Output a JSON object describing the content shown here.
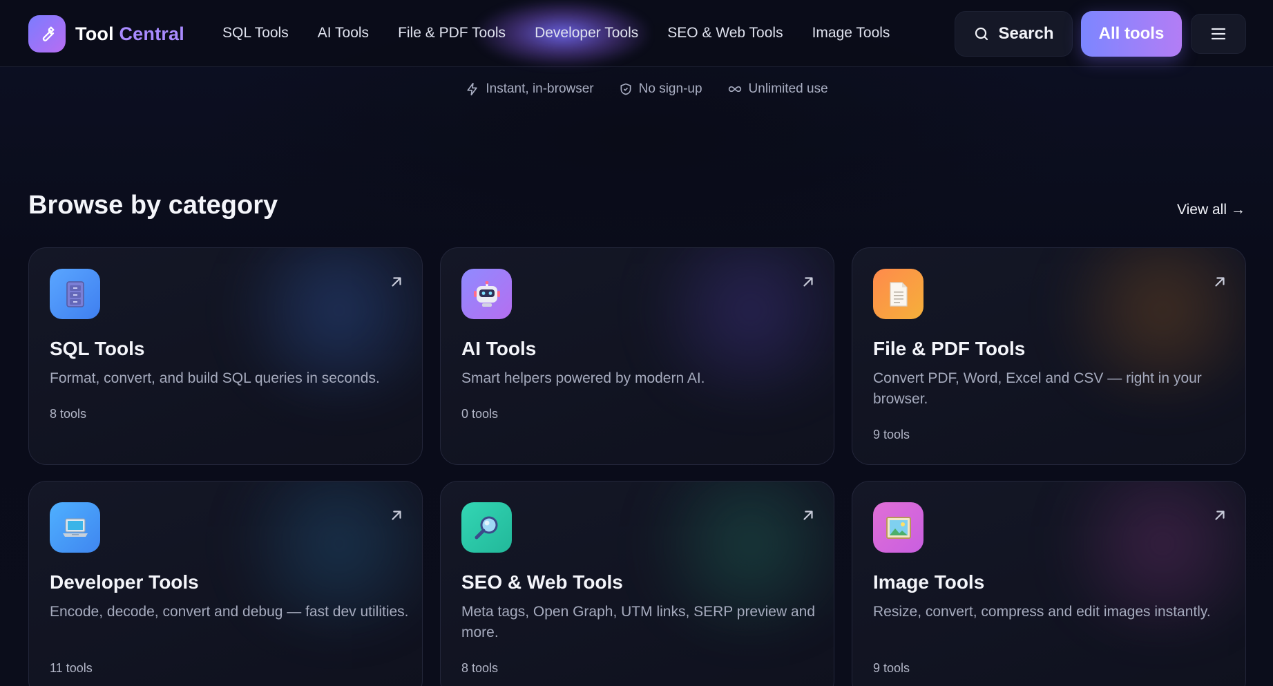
{
  "brand": {
    "name_part1": "Tool ",
    "name_part2": "Central"
  },
  "nav": {
    "links": [
      "SQL Tools",
      "AI Tools",
      "File & PDF Tools",
      "Developer Tools",
      "SEO & Web Tools",
      "Image Tools"
    ],
    "search_label": "Search",
    "all_tools_label": "All tools"
  },
  "features": [
    {
      "icon": "lightning-icon",
      "label": "Instant, in-browser"
    },
    {
      "icon": "shield-icon",
      "label": "No sign-up"
    },
    {
      "icon": "infinity-icon",
      "label": "Unlimited use"
    }
  ],
  "section": {
    "title": "Browse by category",
    "view_all": "View all →"
  },
  "categories": [
    {
      "title": "SQL Tools",
      "desc": "Format, convert, and build SQL queries in seconds.",
      "count": "8 tools",
      "icon": "file-cabinet-icon",
      "accent": "#4f8df5"
    },
    {
      "title": "AI Tools",
      "desc": "Smart helpers powered by modern AI.",
      "count": "0 tools",
      "icon": "robot-icon",
      "accent": "#9b7bff"
    },
    {
      "title": "File & PDF Tools",
      "desc": "Convert PDF, Word, Excel and CSV — right in your browser.",
      "count": "9 tools",
      "icon": "document-icon",
      "accent": "#f59a3c"
    },
    {
      "title": "Developer Tools",
      "desc": "Encode, decode, convert and debug — fast dev utilities.",
      "count": "11 tools",
      "icon": "laptop-icon",
      "accent": "#3fa0f5"
    },
    {
      "title": "SEO & Web Tools",
      "desc": "Meta tags, Open Graph, UTM links, SERP preview and more.",
      "count": "8 tools",
      "icon": "magnifier-icon",
      "accent": "#2fcfae"
    },
    {
      "title": "Image Tools",
      "desc": "Resize, convert, compress and edit images instantly.",
      "count": "9 tools",
      "icon": "picture-icon",
      "accent": "#d36bd8"
    }
  ]
}
